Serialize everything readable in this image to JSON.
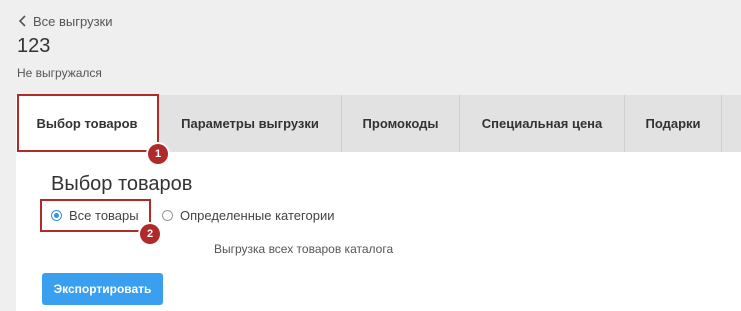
{
  "header": {
    "back_label": "Все выгрузки",
    "title": "123",
    "status": "Не выгружался"
  },
  "tabs": [
    {
      "label": "Выбор товаров",
      "active": true
    },
    {
      "label": "Параметры выгрузки",
      "active": false
    },
    {
      "label": "Промокоды",
      "active": false
    },
    {
      "label": "Специальная цена",
      "active": false
    },
    {
      "label": "Подарки",
      "active": false
    },
    {
      "label": "",
      "active": false
    }
  ],
  "section": {
    "title": "Выбор товаров",
    "options": [
      {
        "label": "Все товары",
        "checked": true
      },
      {
        "label": "Определенные категории",
        "checked": false
      }
    ],
    "help_text": "Выгрузка всех товаров каталога",
    "export_label": "Экспортировать"
  },
  "annotations": [
    {
      "number": "1"
    },
    {
      "number": "2"
    }
  ],
  "colors": {
    "accent": "#3b9ff0",
    "highlight": "#b02a2a",
    "page_bg": "#efefef",
    "tab_bg": "#e2e2e2"
  }
}
